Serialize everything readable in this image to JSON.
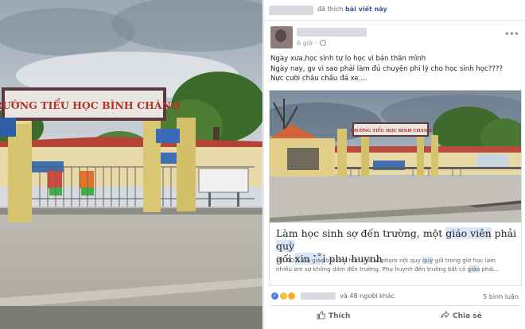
{
  "left_photo": {
    "sign_text": "TRƯỜNG TIỂU HỌC BÌNH CHÁNH"
  },
  "post": {
    "liked_bar": {
      "action": "đã thích",
      "object": "bài viết này"
    },
    "time": "6 giờ",
    "more_icon": "more-options-icon",
    "text_lines": [
      "Ngày xưa,học sinh tự lo học vì bản thân mình",
      "Ngày nay, gv vì sao phải làm đủ chuyện phi lý cho học sinh học????",
      "Nực cười châu chấu đá xe...."
    ],
    "card": {
      "sign_text": "TRƯỜNG TIỂU HỌC BÌNH CHÁNH",
      "title_part1": "Làm học sinh sợ đế",
      "title_part2": "n trường, một ",
      "title_hl1": "giáo viên",
      "title_part3": " phải ",
      "title_hl2": "quỳ",
      "title_part4": "gố",
      "title_part5": "i ",
      "title_hl3": "xin lỗi",
      "title_part6": " phụ huynh",
      "desc_part1": "(NLĐO) - Cô ",
      "desc_hl1": "giáo",
      "desc_part2": " bắt các học sinh vi phạm nội quy ",
      "desc_hl2": "quỳ",
      "desc_part3": " gối trong giờ học làm",
      "desc_line2": "nhiều em sợ không dám đến trường. Phụ huynh đến trường bắt cô ",
      "desc_hl3": "giáo",
      "desc_part4": " phải..."
    },
    "reactions": {
      "others": "và 48 người khác",
      "comments": "5 bình luận"
    },
    "actions": {
      "like": "Thích",
      "share": "Chia sẻ"
    }
  },
  "colors": {
    "fb_link": "#385898",
    "fb_gray": "#616770",
    "sign_bg": "#5a3a3e"
  }
}
